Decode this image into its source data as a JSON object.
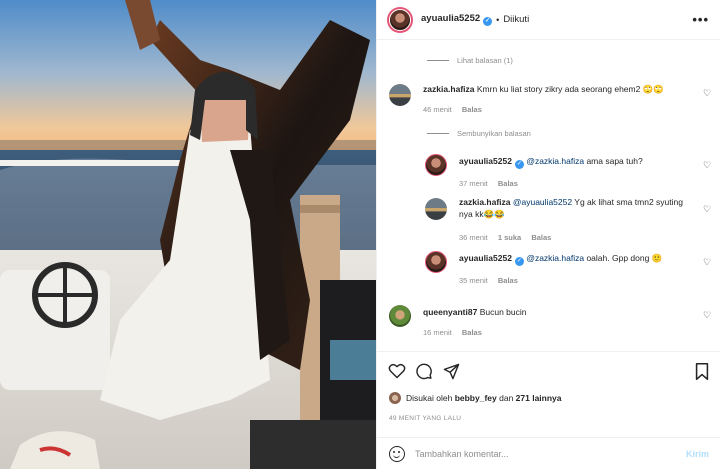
{
  "header": {
    "username": "ayuaulia5252",
    "follow_status": "Diikuti",
    "more_glyph": "•••"
  },
  "comments": {
    "view_replies_1": "Lihat balasan (1)",
    "c1": {
      "username": "zazkia.hafiza",
      "text": "Kmrn ku liat story zikry ada seorang ehem2",
      "time": "46 menit",
      "reply": "Balas"
    },
    "hide_replies": "Sembunyikan balasan",
    "r1": {
      "username": "ayuaulia5252",
      "mention": "@zazkia.hafiza",
      "text": "ama sapa tuh?",
      "time": "37 menit",
      "reply": "Balas"
    },
    "r2": {
      "username": "zazkia.hafiza",
      "mention": "@ayuaulia5252",
      "text": "Yg ak lihat sma tmn2 syuting nya kk",
      "time": "36 menit",
      "likes": "1 suka",
      "reply": "Balas"
    },
    "r3": {
      "username": "ayuaulia5252",
      "mention": "@zazkia.hafiza",
      "text": "oalah. Gpp dong",
      "time": "35 menit",
      "reply": "Balas"
    },
    "c2": {
      "username": "queenyanti87",
      "text": "Bucun bucin",
      "time": "16 menit",
      "reply": "Balas"
    }
  },
  "actions": {
    "liked_prefix": "Disukai oleh",
    "liked_user": "bebby_fey",
    "liked_and": "dan",
    "liked_others": "271 lainnya",
    "time_ago": "49 MENIT YANG LALU"
  },
  "composer": {
    "placeholder": "Tambahkan komentar...",
    "post_label": "Kirim"
  },
  "colors": {
    "link": "#00376b",
    "secondary": "#8e8e8e",
    "post_disabled": "#b2dffc",
    "verified": "#3897f0"
  },
  "icons": [
    "more-options-icon",
    "verified-icon",
    "heart-icon",
    "comment-icon",
    "share-icon",
    "bookmark-icon",
    "emoji-icon"
  ]
}
